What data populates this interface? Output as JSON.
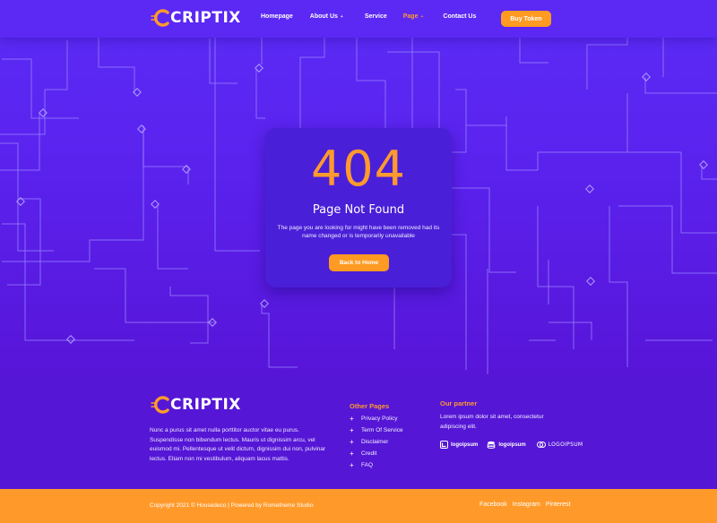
{
  "brand": {
    "name": "CRIPTIX",
    "accent": "#ff9a2e",
    "primary": "#5b28f4"
  },
  "nav": {
    "items": [
      {
        "label": "Homepage",
        "caret": ""
      },
      {
        "label": "About Us",
        "caret": "+"
      },
      {
        "label": "Service",
        "caret": ""
      },
      {
        "label": "Page",
        "caret": "+"
      },
      {
        "label": "Contact Us",
        "caret": ""
      }
    ],
    "cta": "Buy Token"
  },
  "error": {
    "code": "404",
    "title": "Page Not Found",
    "description": "The page you are looking for might have been removed had its name changed or is temporarily unavailable",
    "button": "Back to Home"
  },
  "footer": {
    "about": "Nunc a purus sit amet nulla porttitor auctor vitae eu purus. Suspendisse non bibendum lectus. Mauris ut dignissim arcu, vel euismod mi. Pellentesque ut velit dictum, dignissim dui non, pulvinar lectus. Etiam non mi vestibulum, aliquam lacus mattis.",
    "other_pages": {
      "title": "Other Pages",
      "links": [
        "Privacy Policy",
        "Term Of Service",
        "Disclaimer",
        "Credit",
        "FAQ"
      ]
    },
    "partner": {
      "title": "Our partner",
      "text": "Lorem ipsum dolor sit amet, consectetur adipiscing elit.",
      "logos": [
        "logoipsum",
        "logoipsum",
        "LOGOIPSUM"
      ]
    }
  },
  "bottom": {
    "copyright": "Copyright 2021 © Housedeco | Powered by Rometheme Studio",
    "social": [
      "Facebook",
      "Instagram",
      "Pinterest"
    ]
  },
  "icons": {
    "plus": "+",
    "logo_mark": "c-coin-icon"
  }
}
